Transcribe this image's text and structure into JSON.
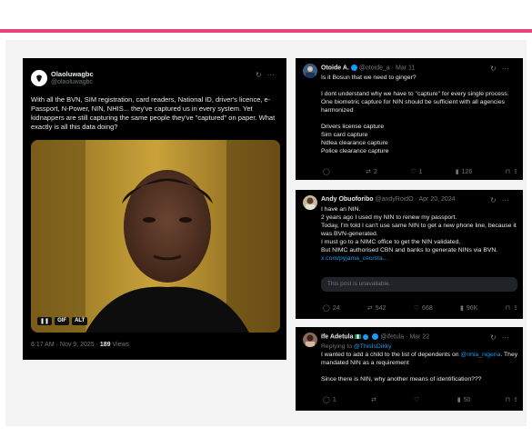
{
  "left_post": {
    "name": "Olaoluwagbc",
    "handle": "@olaoluwagbc",
    "text": "With all the BVN, SIM registration, card readers, National ID, driver's licence, e-Passport, N-Power, NIN, NHIS... they've captured us in every system. Yet kidnappers are still capturing the same people they've \"captured\" on paper. What exactly is all this data doing?",
    "media_badges": [
      "GIF",
      "ALT"
    ],
    "timestamp": "6:17 AM · Nov 9, 2025 · ",
    "views_count": "189",
    "views_label": " Views"
  },
  "post_a": {
    "name": "Otoide A.",
    "handle": "@otoide_a · Mar 11",
    "lines": [
      "Is it Bosun that we need to ginger?",
      "",
      "I dont understand why we have to \"capture\" for every single process. One biometric capture for NIN should be sufficient with all agencies harmonized",
      "",
      "Drivers license capture",
      "Sim card capture",
      "Ndlea clearance capture",
      "Police clearance capture"
    ],
    "stats": {
      "replies": "",
      "reposts": "2",
      "likes": "1",
      "views": "126"
    }
  },
  "post_b": {
    "name": "Andy Obuoforibo",
    "handle": "@andyRoidO · Apr 20, 2024",
    "lines": [
      "I have an NIN.",
      "2 years ago I used my NIN to renew my passport.",
      "Today, I'm told I can't use same NIN to get a new phone line, because it was BVN-generated.",
      "I must go to a NIMC office to get the NIN validated.",
      "But NIMC authorised CBN and banks to generate NINs via BVN."
    ],
    "link": "x.com/pyjama_ceo/sta...",
    "unavailable": "This post is unavailable.",
    "stats": {
      "replies": "24",
      "reposts": "542",
      "likes": "668",
      "views": "96K"
    }
  },
  "post_c": {
    "name": "Ife Adetula",
    "handle": "@ifetula · Mar 22",
    "replying_prefix": "Replying to ",
    "replying_handle": "@ThisIsDikky",
    "line1_prefix": "I wanted to add a child to the list of dependents on ",
    "line1_link": "@nhia_nigeria",
    "line1_suffix": ". They mandated NIN as a requirement",
    "line2": "Since there is NIN, why another means of identification???",
    "stats": {
      "replies": "1",
      "reposts": "",
      "likes": "",
      "views": "50"
    }
  },
  "colors": {
    "accent": "#e8457a",
    "link": "#1d9bf0",
    "card_bg": "#000000",
    "muted": "#71767b"
  }
}
